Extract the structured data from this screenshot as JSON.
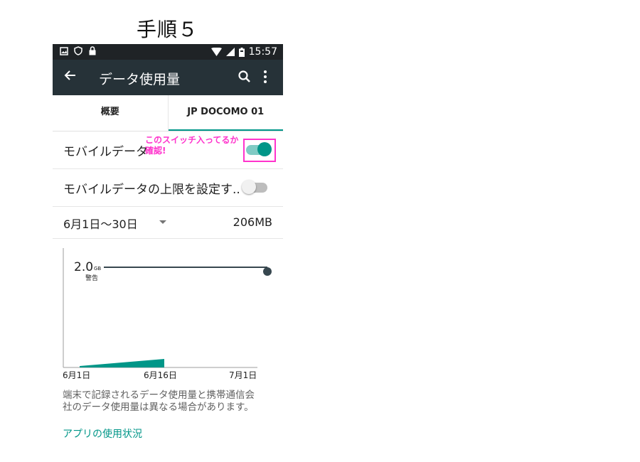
{
  "step_title": "手順５",
  "status_bar": {
    "time": "15:57"
  },
  "toolbar": {
    "title": "データ使用量"
  },
  "tabs": [
    {
      "label": "概要"
    },
    {
      "label": "JP DOCOMO 01"
    }
  ],
  "mobile_data": {
    "label": "モバイルデータ",
    "enabled": true
  },
  "annotation": {
    "line1": "このスイッチ入ってるか",
    "line2": "確認!"
  },
  "limit": {
    "label": "モバイルデータの上限を設定す..",
    "enabled": false
  },
  "cycle": {
    "range": "6月1日～30日",
    "amount": "206MB"
  },
  "chart_data": {
    "type": "area",
    "x_ticks": [
      "6月1日",
      "6月16日",
      "7月1日"
    ],
    "warning": {
      "value": "2.0",
      "unit": "GB",
      "label": "警告"
    },
    "usage_period": [
      "6月1日",
      "6月16日"
    ]
  },
  "description": {
    "line1": "端末で記録されるデータ使用量と携帯通信会",
    "line2": "社のデータ使用量は異なる場合があります。"
  },
  "apps_link": "アプリの使用状況",
  "colors": {
    "accent": "#009688",
    "toolbar": "#263238",
    "statusbar": "#1f2326",
    "annotation": "#ff33cc"
  }
}
